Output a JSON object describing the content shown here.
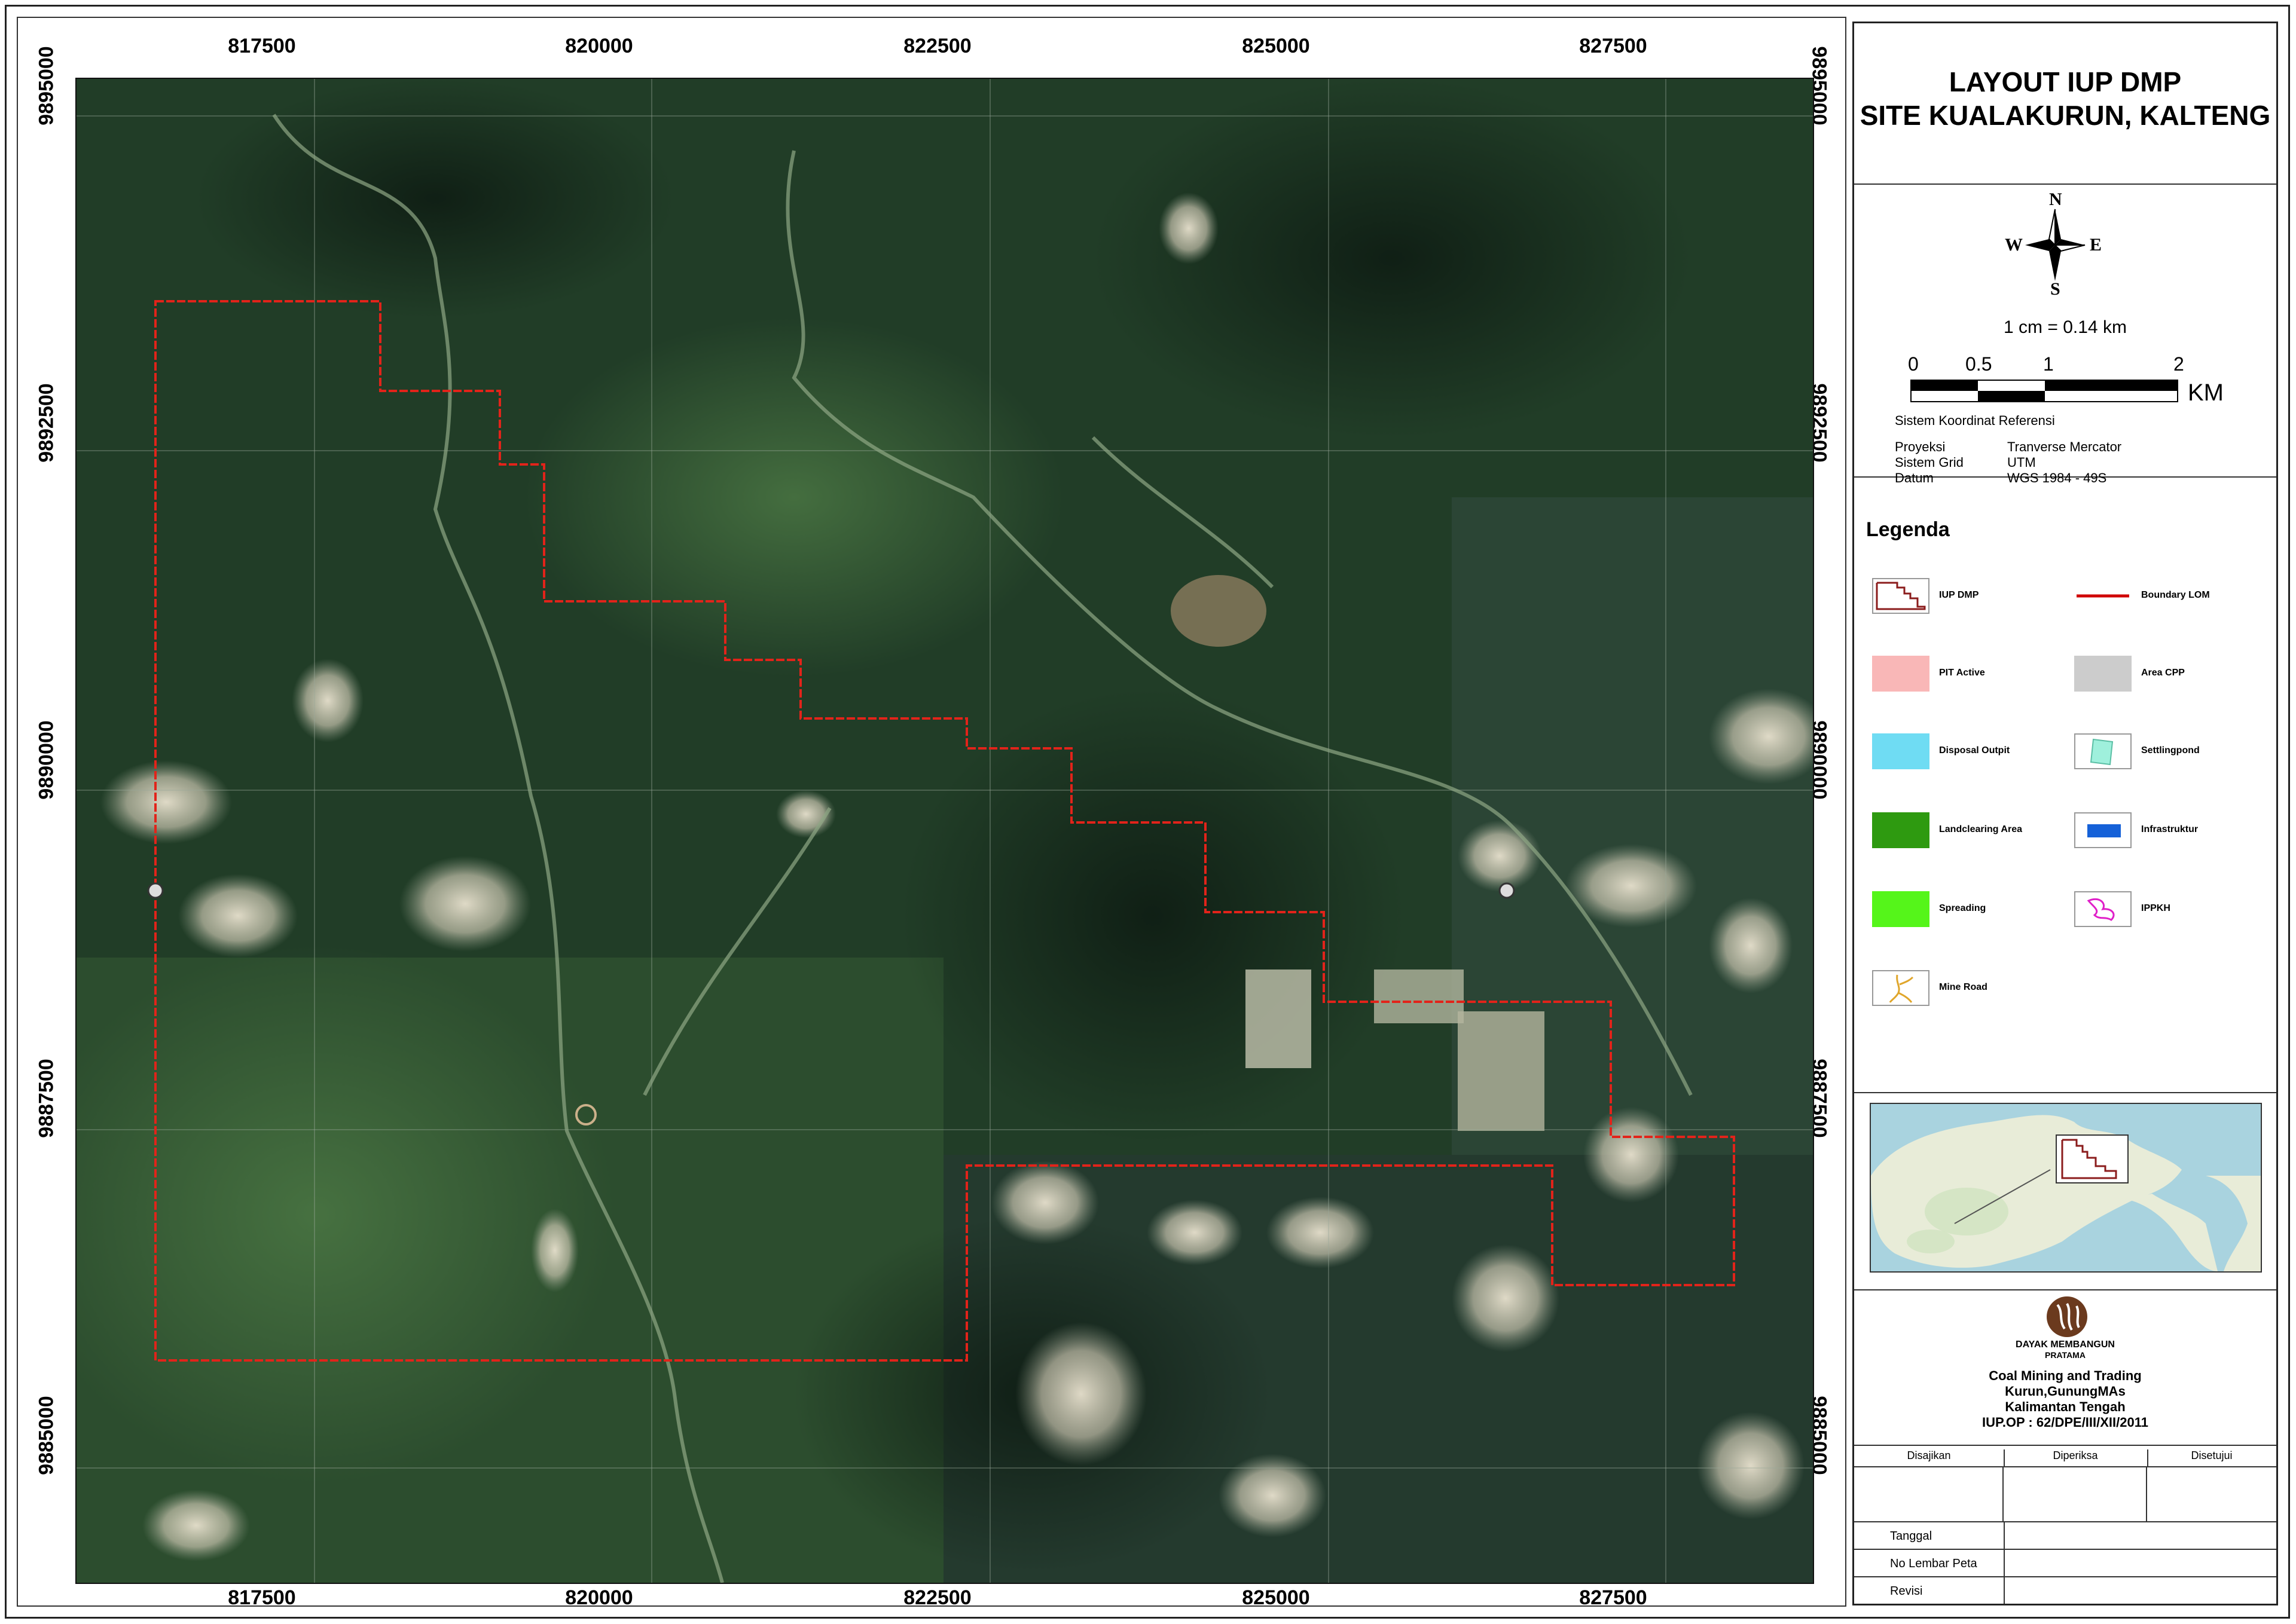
{
  "title": {
    "line1": "LAYOUT IUP DMP",
    "line2": "SITE KUALAKURUN, KALTENG"
  },
  "compass": {
    "n": "N",
    "s": "S",
    "e": "E",
    "w": "W",
    "icon": "compass-rose-icon"
  },
  "scale": {
    "ratio_text": "1 cm = 0.14 km",
    "ticks": [
      "0",
      "0.5",
      "1",
      "2"
    ],
    "unit": "KM"
  },
  "crs": {
    "heading": "Sistem Koordinat Referensi",
    "rows": [
      {
        "label": "Proyeksi",
        "value": "Tranverse Mercator"
      },
      {
        "label": "Sistem Grid",
        "value": "UTM"
      },
      {
        "label": "Datum",
        "value": "WGS 1984 - 49S"
      }
    ]
  },
  "legend": {
    "title": "Legenda",
    "items": [
      {
        "label": "IUP DMP",
        "icon": "iup-boundary-icon"
      },
      {
        "label": "Boundary LOM",
        "icon": "red-line-icon",
        "color": "#d00000"
      },
      {
        "label": "PIT Active",
        "icon": "pink-fill-icon",
        "color": "#f9b7b7"
      },
      {
        "label": "Area CPP",
        "icon": "grey-fill-icon",
        "color": "#cccccc"
      },
      {
        "label": "Disposal Outpit",
        "icon": "cyan-fill-icon",
        "color": "#6fdcf3"
      },
      {
        "label": "Settlingpond",
        "icon": "settlingpond-icon",
        "color": "#9ff0dc"
      },
      {
        "label": "Landclearing Area",
        "icon": "dark-green-fill-icon",
        "color": "#2e9a10"
      },
      {
        "label": "Infrastruktur",
        "icon": "blue-rect-icon",
        "color": "#1561d8"
      },
      {
        "label": "Spreading",
        "icon": "lime-fill-icon",
        "color": "#55f51a"
      },
      {
        "label": "IPPKH",
        "icon": "ippkh-icon",
        "color": "#e01fc8"
      },
      {
        "label": "Mine Road",
        "icon": "mine-road-icon",
        "color": "#e0a62b"
      }
    ]
  },
  "company": {
    "logo_text": "DAYAK MEMBANGUN",
    "logo_sub": "PRATAMA",
    "lines": [
      "Coal Mining and Trading",
      "Kurun,GunungMAs",
      "Kalimantan Tengah",
      "IUP.OP : 62/DPE/III/XII/2011"
    ]
  },
  "signatures": {
    "cols": [
      "Disajikan",
      "Diperiksa",
      "Disetujui"
    ],
    "rows": [
      "Tanggal",
      "No Lembar Peta",
      "Revisi"
    ]
  },
  "grid": {
    "x_labels": [
      "817500",
      "820000",
      "822500",
      "825000",
      "827500"
    ],
    "y_labels": [
      "9895000",
      "9892500",
      "9890000",
      "9887500",
      "9885000"
    ]
  },
  "colors": {
    "boundary": "#e2231a",
    "forest": "#1f3a25"
  }
}
